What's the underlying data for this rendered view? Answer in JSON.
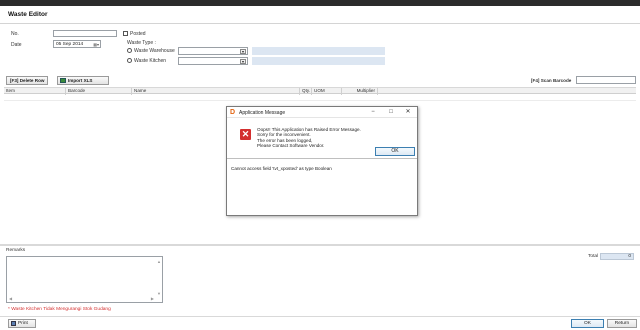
{
  "window": {
    "title": "Waste Editor"
  },
  "form": {
    "no_label": "No.",
    "no_value": "",
    "date_label": "Date",
    "date_value": "05 Sep 2014",
    "posted_label": "Posted",
    "waste_type_label": "Waste Type :",
    "waste_warehouse_label": "Waste Warehouse",
    "waste_kitchen_label": "Waste Kitchen"
  },
  "toolbar": {
    "delete_row_label": "[F3] Delete Row",
    "import_xls_label": "Import XLS",
    "scan_barcode_label": "[F4] Scan Barcode",
    "scan_barcode_value": ""
  },
  "grid": {
    "columns": [
      "Item",
      "Barcode",
      "Name",
      "Qty.",
      "UOM",
      "Multiplier"
    ]
  },
  "dialog": {
    "title": "Application Message",
    "minimize": "−",
    "maximize": "□",
    "close": "✕",
    "message_lines": [
      "Oops!! This Application has Raised Error Message.",
      "Sorry for the inconvenient.",
      "The error has been logged,",
      "Please Contact Software Vendor."
    ],
    "ok_label": "OK",
    "detail": "Cannot access field 'tvt_xposted' as type Boolean"
  },
  "remarks": {
    "label": "Remarks",
    "value": ""
  },
  "warning": "* Waste Kitchen Tidak Mengurangi Stok Gudang",
  "total": {
    "label": "Total",
    "value": "0"
  },
  "footer": {
    "print_label": "Print",
    "ok_label": "OK",
    "return_label": "Return"
  }
}
